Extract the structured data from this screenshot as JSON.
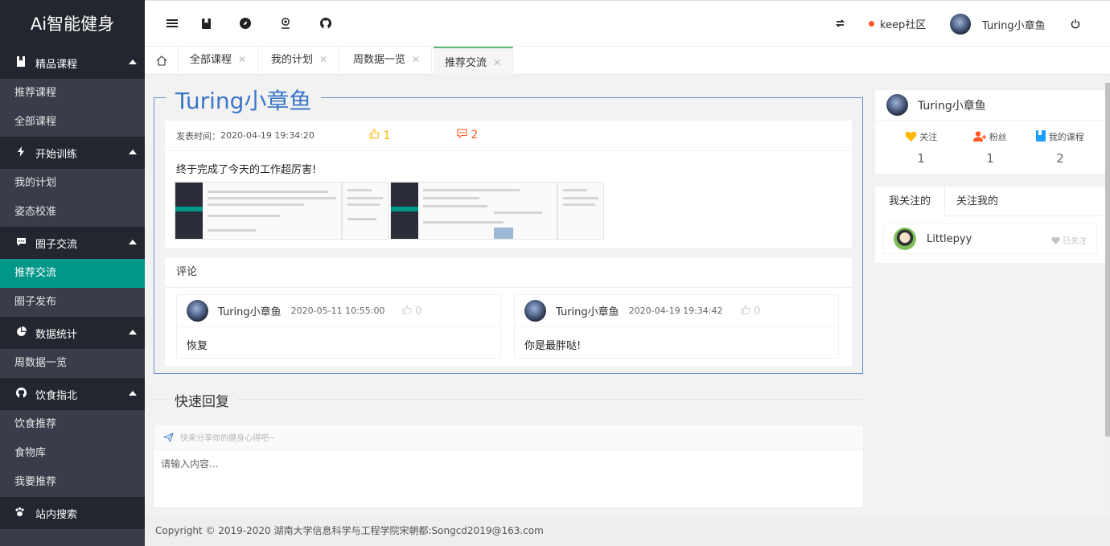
{
  "app": {
    "title": "Ai智能健身"
  },
  "sidebar": {
    "groups": [
      {
        "label": "精品课程",
        "items": [
          "推荐课程",
          "全部课程"
        ]
      },
      {
        "label": "开始训练",
        "items": [
          "我的计划",
          "姿态校准"
        ]
      },
      {
        "label": "圈子交流",
        "items": [
          "推荐交流",
          "圈子发布"
        ]
      },
      {
        "label": "数据统计",
        "items": [
          "周数据一览"
        ]
      },
      {
        "label": "饮食指北",
        "items": [
          "饮食推荐",
          "食物库",
          "我要推荐"
        ]
      }
    ],
    "search_label": "站内搜索",
    "active_item": "推荐交流"
  },
  "header": {
    "community": "keep社区",
    "user": "Turing小章鱼"
  },
  "tabs": [
    "全部课程",
    "我的计划",
    "周数据一览",
    "推荐交流"
  ],
  "post": {
    "author": "Turing小章鱼",
    "time_label": "发表时间：",
    "time": "2020-04-19 19:34:20",
    "likes": "1",
    "comments": "2",
    "content": "终于完成了今天的工作超厉害!"
  },
  "comments_section": {
    "title": "评论",
    "items": [
      {
        "name": "Turing小章鱼",
        "time": "2020-05-11 10:55:00",
        "likes": "0",
        "text": "恢复"
      },
      {
        "name": "Turing小章鱼",
        "time": "2020-04-19 19:34:42",
        "likes": "0",
        "text": "你是最胖哒!"
      }
    ]
  },
  "reply": {
    "title": "快速回复",
    "hint": "快来分享你的健身心得吧~",
    "placeholder": "请输入内容..."
  },
  "profile": {
    "name": "Turing小章鱼",
    "stats": [
      {
        "label": "关注",
        "value": "1"
      },
      {
        "label": "粉丝",
        "value": "1"
      },
      {
        "label": "我的课程",
        "value": "2"
      }
    ]
  },
  "follow": {
    "tabs": [
      "我关注的",
      "关注我的"
    ],
    "items": [
      {
        "name": "Littlepyy",
        "status": "已关注"
      }
    ]
  },
  "footer": {
    "text": "Copyright © 2019-2020 湖南大学信息科学与工程学院宋朝都:Songcd2019@163.com"
  },
  "colors": {
    "accent": "#009688",
    "sidebar": "#393d49",
    "sidebar_dark": "#23262e",
    "legend": "#3c76c9",
    "like": "#ffb800",
    "comment": "#ff5722"
  }
}
